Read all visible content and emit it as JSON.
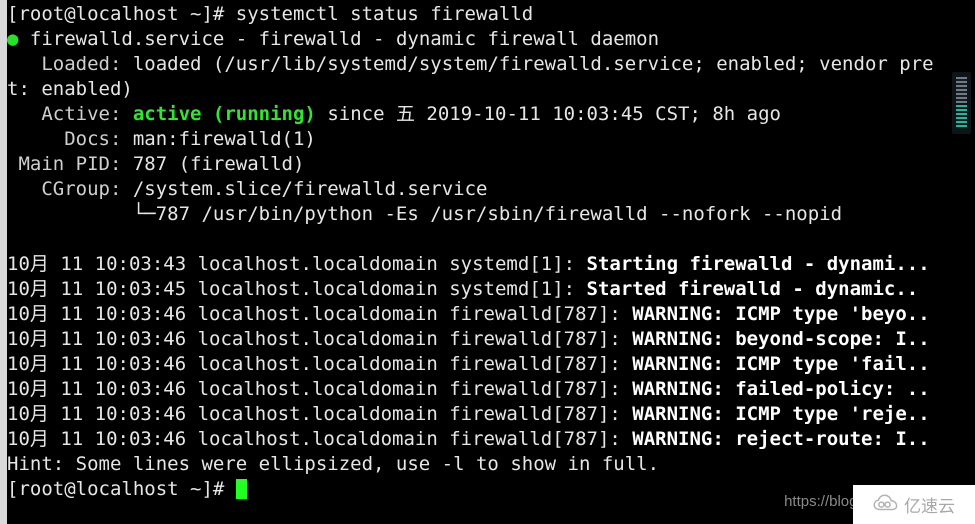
{
  "terminal": {
    "prompt": "[root@localhost ~]# ",
    "command": "systemctl status firewalld",
    "status_dot": "●",
    "unit_header": " firewalld.service - firewalld - dynamic firewall daemon",
    "loaded_label": "   Loaded: ",
    "loaded_value": "loaded (/usr/lib/systemd/system/firewalld.service; enabled; vendor pre",
    "loaded_wrap": "t: enabled)",
    "active_label": "   Active: ",
    "active_state": "active (running)",
    "active_rest": " since 五 2019-10-11 10:03:45 CST; 8h ago",
    "docs_label": "     Docs: ",
    "docs_value": "man:firewalld(1)",
    "mainpid_label": " Main PID: ",
    "mainpid_value": "787 (firewalld)",
    "cgroup_label": "   CGroup: ",
    "cgroup_value": "/system.slice/firewalld.service",
    "cgroup_tree": "           └─787 /usr/bin/python -Es /usr/sbin/firewalld --nofork --nopid",
    "hint": "Hint: Some lines were ellipsized, use -l to show in full.",
    "final_prompt": "[root@localhost ~]# ",
    "log_lines": [
      {
        "prefix": "10月 11 10:03:43 localhost.localdomain systemd[1]: ",
        "message": "Starting firewalld - dynami..."
      },
      {
        "prefix": "10月 11 10:03:45 localhost.localdomain systemd[1]: ",
        "message": "Started firewalld - dynamic.."
      },
      {
        "prefix": "10月 11 10:03:46 localhost.localdomain firewalld[787]: ",
        "message": "WARNING: ICMP type 'beyo.."
      },
      {
        "prefix": "10月 11 10:03:46 localhost.localdomain firewalld[787]: ",
        "message": "WARNING: beyond-scope: I.."
      },
      {
        "prefix": "10月 11 10:03:46 localhost.localdomain firewalld[787]: ",
        "message": "WARNING: ICMP type 'fail.."
      },
      {
        "prefix": "10月 11 10:03:46 localhost.localdomain firewalld[787]: ",
        "message": "WARNING: failed-policy: .."
      },
      {
        "prefix": "10月 11 10:03:46 localhost.localdomain firewalld[787]: ",
        "message": "WARNING: ICMP type 'reje.."
      },
      {
        "prefix": "10月 11 10:03:46 localhost.localdomain firewalld[787]: ",
        "message": "WARNING: reject-route: I.."
      }
    ]
  },
  "watermark": {
    "url_text": "https://blog.csd",
    "logo_text": "亿速云"
  },
  "colors": {
    "background": "#000000",
    "foreground": "#d8d8d8",
    "green": "#2ee82e",
    "cursor": "#22ff22",
    "bright_white": "#ffffff"
  }
}
